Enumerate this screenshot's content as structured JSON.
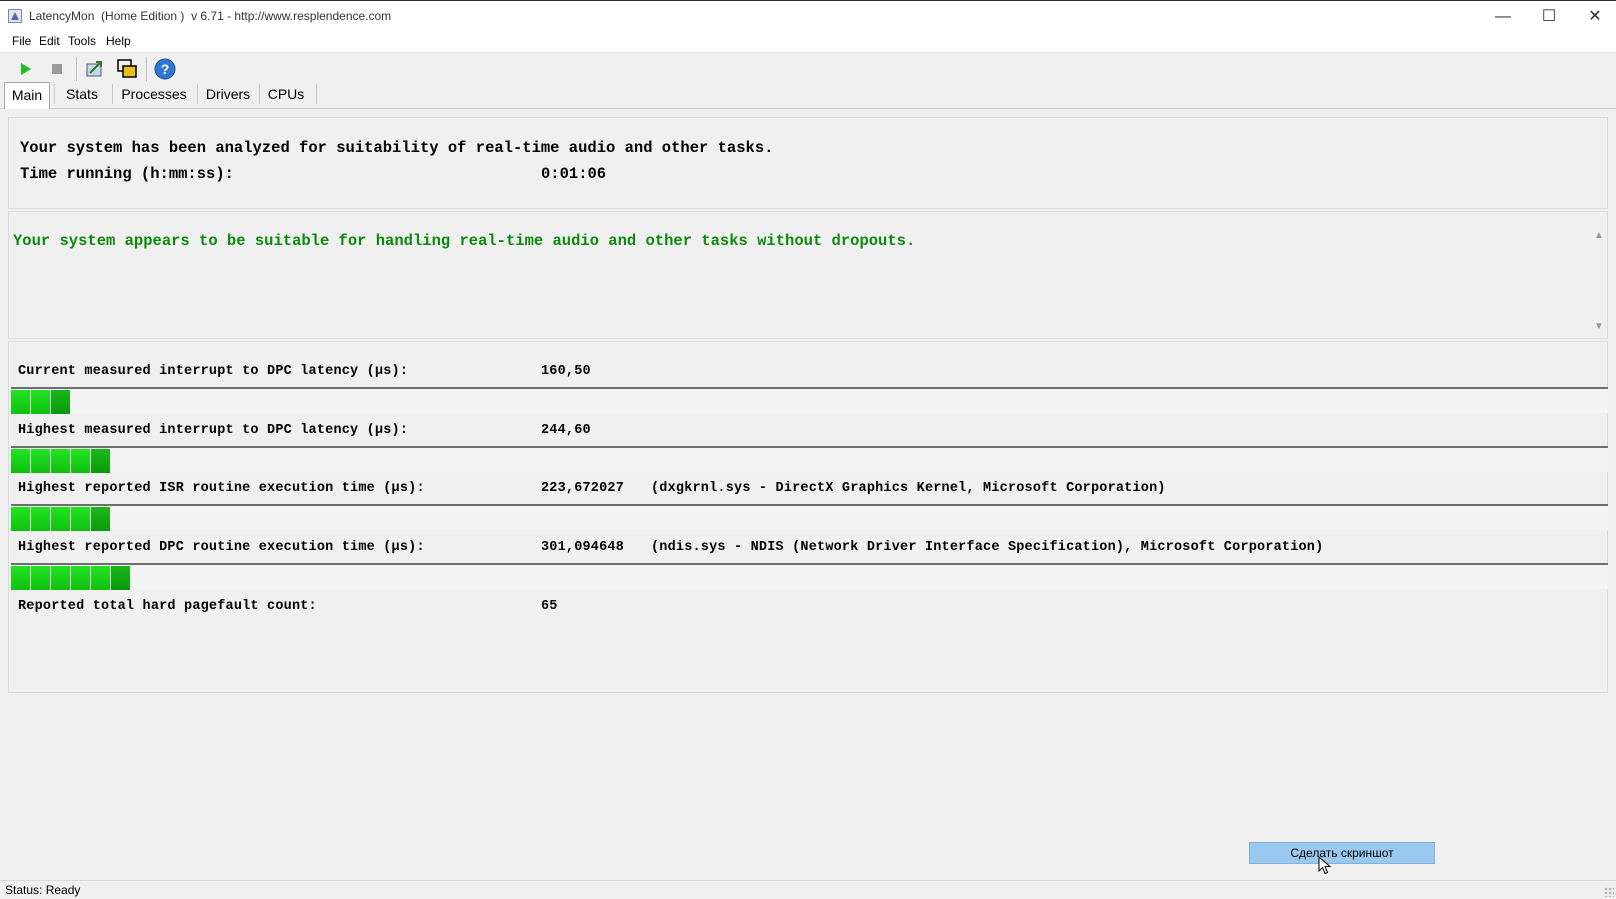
{
  "window": {
    "title": "LatencyMon  (Home Edition )  v 6.71 - http://www.resplendence.com",
    "minimize": "—",
    "maximize": "☐",
    "close": "✕"
  },
  "menu": [
    "File",
    "Edit",
    "Tools",
    "Help"
  ],
  "toolbar": {
    "start_icon": "play-icon",
    "stop_icon": "stop-icon",
    "submit_icon": "upload-report-icon",
    "windows_icon": "window-icon",
    "help_icon": "help-icon"
  },
  "tabs": [
    "Main",
    "Stats",
    "Processes",
    "Drivers",
    "CPUs"
  ],
  "active_tab": "Main",
  "summary": {
    "line1": "Your system has been analyzed for suitability of real-time audio and other tasks.",
    "time_label": "Time running (h:mm:ss):",
    "time_value": "0:01:06"
  },
  "verdict": {
    "text": "Your system appears to be suitable for handling real-time audio and other tasks without dropouts.",
    "color": "#0b8a0b"
  },
  "metrics": [
    {
      "label": "Current measured interrupt to DPC latency (µs):",
      "value": "160,50",
      "detail": "",
      "segments": 3
    },
    {
      "label": "Highest measured interrupt to DPC latency (µs):",
      "value": "244,60",
      "detail": "",
      "segments": 5
    },
    {
      "label": "Highest reported ISR routine execution time (µs):",
      "value": "223,672027",
      "detail": "(dxgkrnl.sys - DirectX Graphics Kernel, Microsoft Corporation)",
      "segments": 5
    },
    {
      "label": "Highest reported DPC routine execution time (µs):",
      "value": "301,094648",
      "detail": "(ndis.sys - NDIS (Network Driver Interface Specification), Microsoft Corporation)",
      "segments": 6
    },
    {
      "label": "Reported total hard pagefault count:",
      "value": "65",
      "detail": ""
    }
  ],
  "screenshot_button": "Сделать скриншот",
  "status": "Status: Ready"
}
